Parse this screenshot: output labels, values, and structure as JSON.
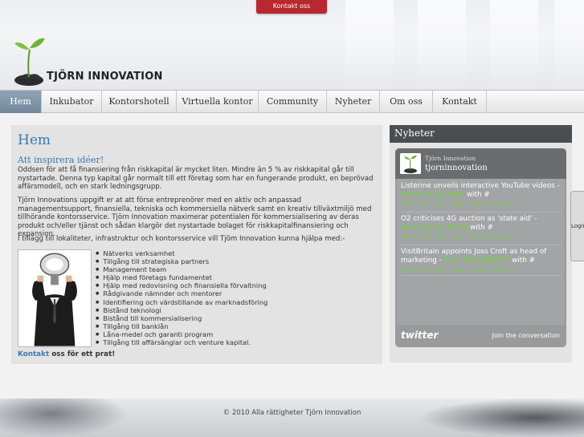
{
  "top": {
    "contact_tab": "Kontakt oss"
  },
  "logo": {
    "text": "TJÖRN INNOVATION"
  },
  "nav": [
    {
      "label": "Hem"
    },
    {
      "label": "Inkubator"
    },
    {
      "label": "Kontorshotell"
    },
    {
      "label": "Virtuella kontor"
    },
    {
      "label": "Community"
    },
    {
      "label": "Nyheter"
    },
    {
      "label": "Om oss"
    },
    {
      "label": "Kontakt"
    }
  ],
  "main": {
    "title": "Hem",
    "subtitle": "Att inspirera idéer!",
    "para1": "Oddsen för att få finansiering från riskkapital är mycket liten. Mindre än 5 % av riskkapital går till nystartade. Denna typ kapital går normalt till ett företag som har en fungerande produkt, en beprövad affärsmodell, och en stark ledningsgrupp.",
    "para2": "Tjörn Innovations uppgift er at att förse entreprenörer med en aktiv och anpassad managementsupport, finansiella, tekniska och kommersiella nätverk samt en kreativ tillväxtmiljö med tillhörande kontorsservice. Tjörn Innovation maximerar potentialen för kommersialisering av deras produkt och/eller tjänst och sådan klargör det nystartade bolaget för riskkapitalfinansiering och expansion.",
    "para3": "I tillägg till lokaliteter, infrastruktur och kontorsservice vill Tjöm Innovation kunna hjälpa med:-",
    "services": [
      "Nätverks verksamhet",
      "Tillgång till strategiska partners",
      "Management team",
      "Hjälp med företags fundamentet",
      "Hjälp med redovisning och finansiella förvaltning",
      "Rådgivande nämnder och mentorer",
      "Identifiering och värdstillande av marknadsföring",
      "Bistånd teknologi",
      "Bistånd till kommersialisering",
      "Tillgång till banklån",
      "Låna-medel och garanti program",
      "Tillgång till affärsänglar och venture kapital."
    ],
    "cta_link": "Kontakt",
    "cta_rest": " oss för ett prat!"
  },
  "sidebar": {
    "title": "Nyheter",
    "twitter": {
      "name": "Tjörn Innovation",
      "handle": "tjorninnovation",
      "tweets": [
        {
          "text": "Listerine unveils interactive YouTube videos - ",
          "link": "http://bit.ly/jjgbbu",
          "after": " with #",
          "meta": "about 1 hour ago · reply · retweet · favorite"
        },
        {
          "text": "O2 criticises 4G auction as 'state aid' - ",
          "link": "http://bit.ly/jUS9YZ",
          "after": " with #",
          "meta": "about 1 hour ago · reply · retweet · favorite"
        },
        {
          "text": "VisitBritain appoints Joss Croft as head of marketing - ",
          "link": "http://bit.ly/lFSBBY",
          "after": " with #",
          "meta": "about 1 hour ago · reply · retweet · favorite"
        }
      ],
      "logo": "twitter",
      "join": "Join the conversation"
    },
    "login_tab": "Login"
  },
  "footer": {
    "text": "© 2010 Alla rättigheter Tjörn Innovation"
  },
  "colors": {
    "accent": "#3a7ab3",
    "nav_active": "#7d92a4",
    "tweet_link": "#6fd33a",
    "contact_tab": "#b8282e"
  }
}
